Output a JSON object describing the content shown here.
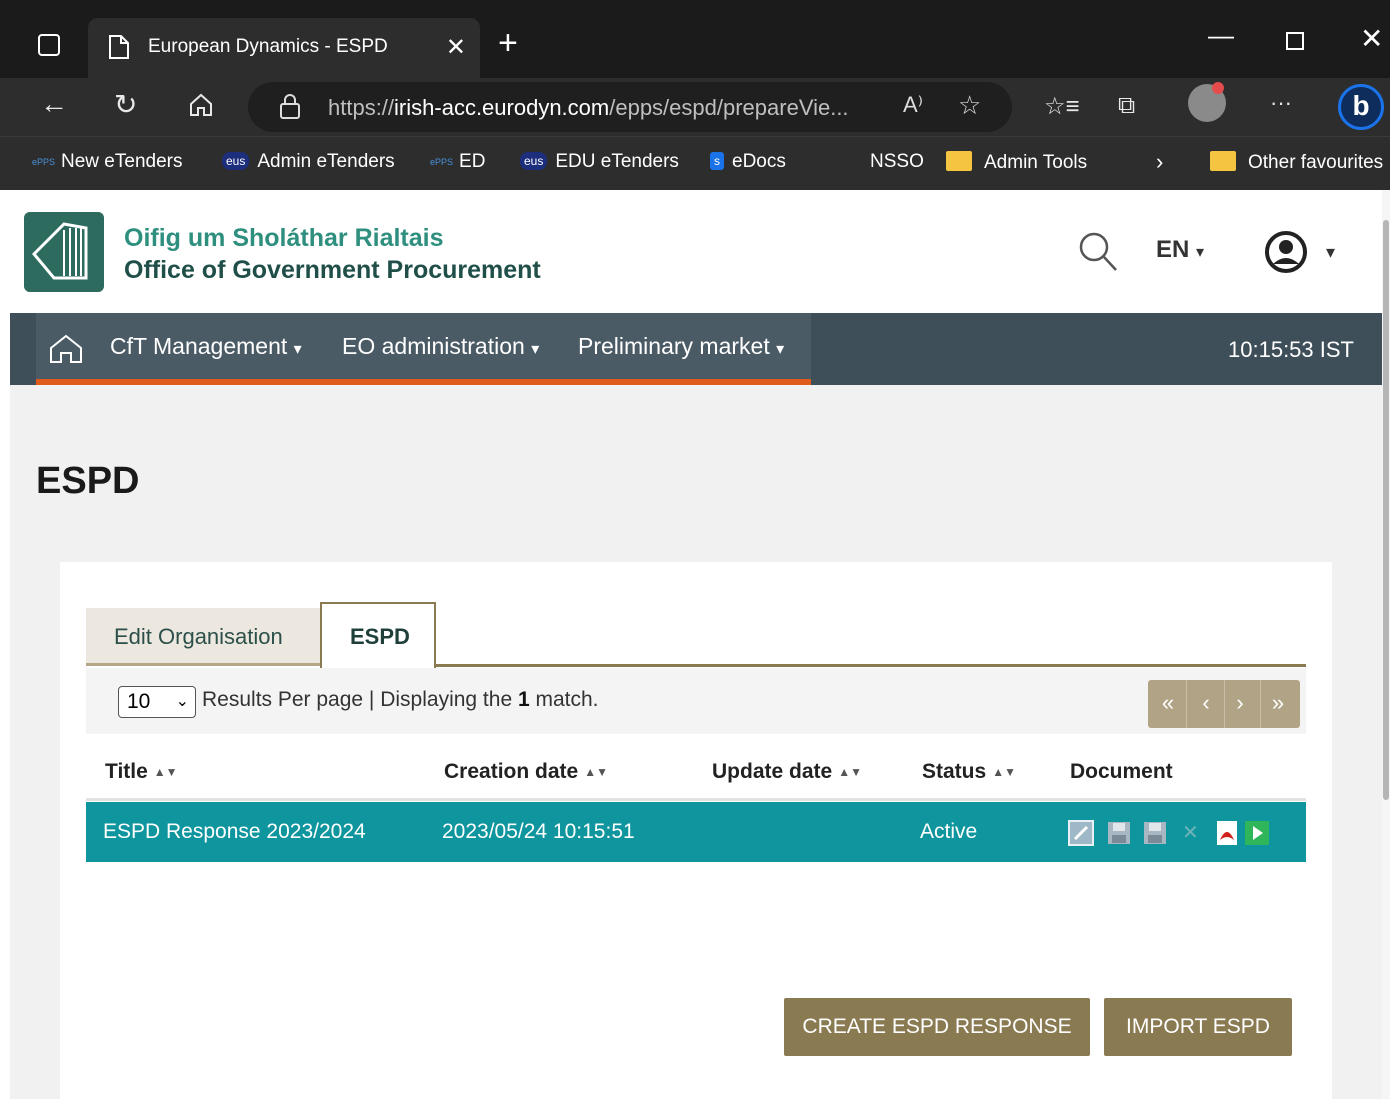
{
  "browser": {
    "tab_title": "European Dynamics - ESPD",
    "url_prefix": "https://",
    "url_host": "irish-acc.eurodyn.com",
    "url_path": "/epps/espd/prepareVie...",
    "read_aloud": "A⁾"
  },
  "favourites": [
    {
      "label": "New eTenders",
      "icon": "epps"
    },
    {
      "label": "Admin eTenders",
      "icon": "eus"
    },
    {
      "label": "ED",
      "icon": "epps"
    },
    {
      "label": "EDU eTenders",
      "icon": "eus"
    },
    {
      "label": "eDocs",
      "icon": "sdoc"
    },
    {
      "label": "NSSO",
      "icon": "none"
    },
    {
      "label": "Admin Tools",
      "icon": "folder"
    },
    {
      "label": "Other favourites",
      "icon": "folder"
    }
  ],
  "fav_badges": {
    "epps": "ePPS",
    "eus": "eus",
    "sdoc": "s"
  },
  "site": {
    "name_irish": "Oifig um Sholáthar Rialtais",
    "name_english": "Office of Government Procurement",
    "language": "EN"
  },
  "nav": {
    "items": [
      "CfT Management",
      "EO administration",
      "Preliminary market"
    ],
    "time": "10:15:53 IST"
  },
  "page": {
    "title": "ESPD"
  },
  "tabs": {
    "edit_org": "Edit Organisation",
    "espd": "ESPD"
  },
  "results": {
    "per_page": "10",
    "prefix": "Results Per page | Displaying the",
    "count": "1",
    "suffix": "match."
  },
  "pager": {
    "first": "«",
    "prev": "‹",
    "next": "›",
    "last": "»"
  },
  "table": {
    "columns": [
      "Title",
      "Creation date",
      "Update date",
      "Status",
      "Document"
    ],
    "rows": [
      {
        "title": "ESPD Response 2023/2024",
        "created": "2023/05/24 10:15:51",
        "updated": "",
        "status": "Active"
      }
    ]
  },
  "actions": {
    "create": "CREATE ESPD RESPONSE",
    "import": "IMPORT ESPD"
  },
  "colors": {
    "nav_bg": "#3f4f5a",
    "accent_orange": "#e05a1c",
    "row_teal": "#0e959e",
    "button_bronze": "#8a7a52"
  }
}
